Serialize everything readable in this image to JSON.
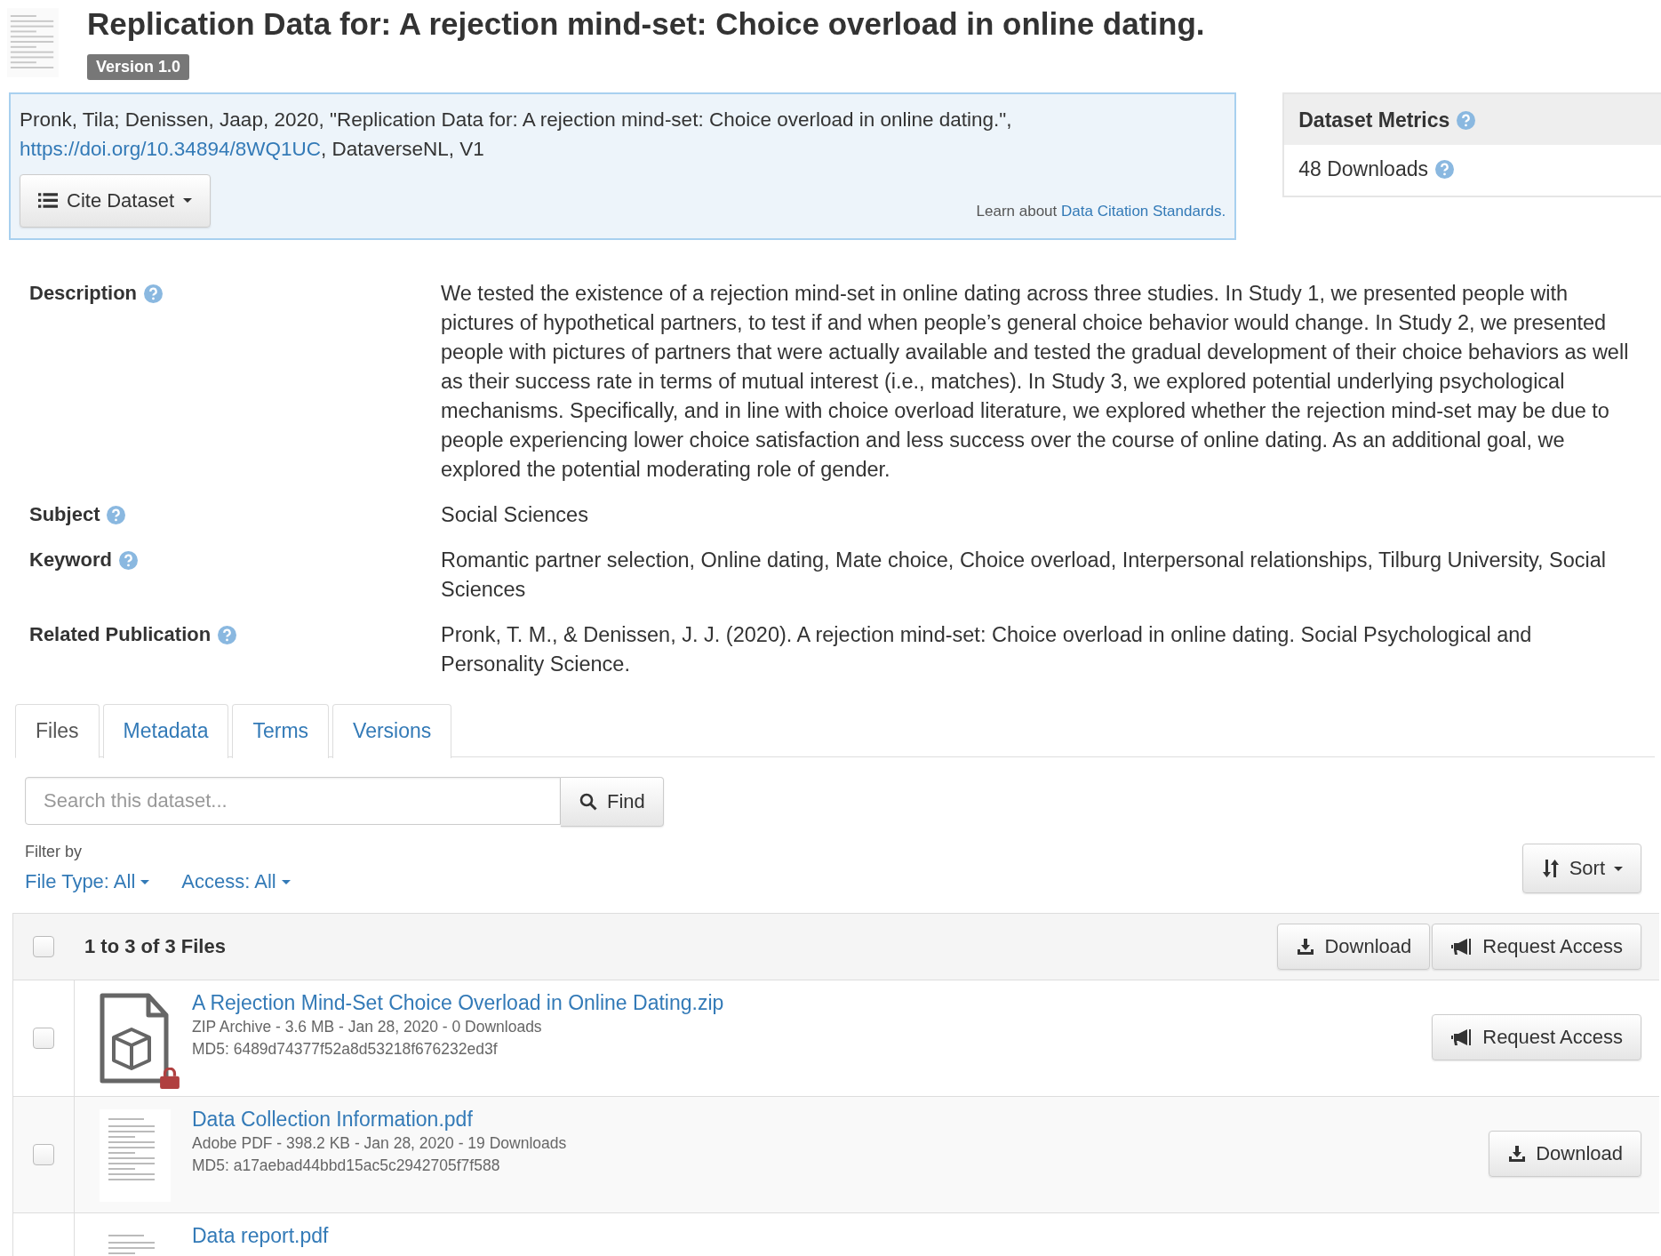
{
  "title": "Replication Data for: A rejection mind-set: Choice overload in online dating.",
  "version_badge": "Version 1.0",
  "citation": {
    "text": "Pronk, Tila; Denissen, Jaap, 2020, \"Replication Data for: A rejection mind-set: Choice overload in online dating.\",",
    "doi_link": "https://doi.org/10.34894/8WQ1UC",
    "suffix": ", DataverseNL, V1",
    "cite_button": "Cite Dataset",
    "learn_text": "Learn about",
    "learn_link": "Data Citation Standards."
  },
  "metrics": {
    "title": "Dataset Metrics",
    "downloads": "48 Downloads"
  },
  "fields": [
    {
      "label": "Description",
      "value": "We tested the existence of a rejection mind-set in online dating across three studies. In Study 1, we presented people with pictures of hypothetical partners, to test if and when people’s general choice behavior would change. In Study 2, we presented people with pictures of partners that were actually available and tested the gradual development of their choice behaviors as well as their success rate in terms of mutual interest (i.e., matches). In Study 3, we explored potential underlying psychological mechanisms. Specifically, and in line with choice overload literature, we explored whether the rejection mind-set may be due to people experiencing lower choice satisfaction and less success over the course of online dating. As an additional goal, we explored the potential moderating role of gender."
    },
    {
      "label": "Subject",
      "value": "Social Sciences"
    },
    {
      "label": "Keyword",
      "value": "Romantic partner selection, Online dating, Mate choice, Choice overload, Interpersonal relationships, Tilburg University, Social Sciences"
    },
    {
      "label": "Related Publication",
      "value": "Pronk, T. M., & Denissen, J. J. (2020). A rejection mind-set: Choice overload in online dating. Social Psychological and Personality Science."
    }
  ],
  "tabs": [
    {
      "label": "Files",
      "selected": true
    },
    {
      "label": "Metadata",
      "selected": false
    },
    {
      "label": "Terms",
      "selected": false
    },
    {
      "label": "Versions",
      "selected": false
    }
  ],
  "search": {
    "placeholder": "Search this dataset...",
    "button": "Find"
  },
  "filter": {
    "label": "Filter by",
    "options": [
      "File Type: All",
      "Access: All"
    ]
  },
  "sort_button": "Sort",
  "files_table": {
    "header": "1 to 3 of 3 Files",
    "select_all_checked": false,
    "actions": [
      {
        "kind": "download",
        "label": "Download"
      },
      {
        "kind": "request",
        "label": "Request Access"
      }
    ],
    "rows": [
      {
        "kind": "zip",
        "checked": false,
        "locked": true,
        "name": "A Rejection Mind-Set Choice Overload in Online Dating.zip",
        "info": "ZIP Archive - 3.6 MB - Jan 28, 2020 - 0 Downloads",
        "md5": "MD5: 6489d74377f52a8d53218f676232ed3f",
        "action": {
          "kind": "request",
          "label": "Request Access"
        }
      },
      {
        "kind": "pdf",
        "checked": false,
        "locked": false,
        "name": "Data Collection Information.pdf",
        "info": "Adobe PDF - 398.2 KB - Jan 28, 2020 - 19 Downloads",
        "md5": "MD5: a17aebad44bbd15ac5c2942705f7f588",
        "action": {
          "kind": "download",
          "label": "Download"
        }
      },
      {
        "kind": "pdf",
        "locked": false,
        "name": "Data report.pdf"
      }
    ]
  }
}
